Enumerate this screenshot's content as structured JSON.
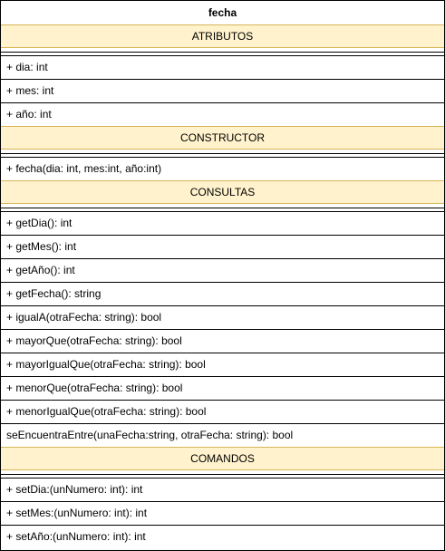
{
  "class_name": "fecha",
  "sections": {
    "atributos": "ATRIBUTOS",
    "constructor": "CONSTRUCTOR",
    "consultas": "CONSULTAS",
    "comandos": "COMANDOS"
  },
  "atributos": [
    "+ dia: int",
    "+ mes: int",
    "+ año: int"
  ],
  "constructor": [
    "+ fecha(dia: int, mes:int, año:int)"
  ],
  "consultas": [
    " + getDia(): int",
    "+ getMes(): int",
    "+ getAño(): int",
    "+ getFecha(): string",
    "+ igualA(otraFecha: string): bool",
    "+ mayorQue(otraFecha: string): bool",
    "+ mayorIgualQue(otraFecha: string): bool",
    "+ menorQue(otraFecha: string): bool",
    "+ menorIgualQue(otraFecha: string): bool",
    "seEncuentraEntre(unaFecha:string, otraFecha: string): bool"
  ],
  "comandos": [
    "+ setDia:(unNumero: int): int",
    "+ setMes:(unNumero: int): int",
    "+ setAño:(unNumero: int): int"
  ],
  "colors": {
    "section_fill": "#fff2cc",
    "section_border": "#d6b656",
    "line": "#000000"
  }
}
